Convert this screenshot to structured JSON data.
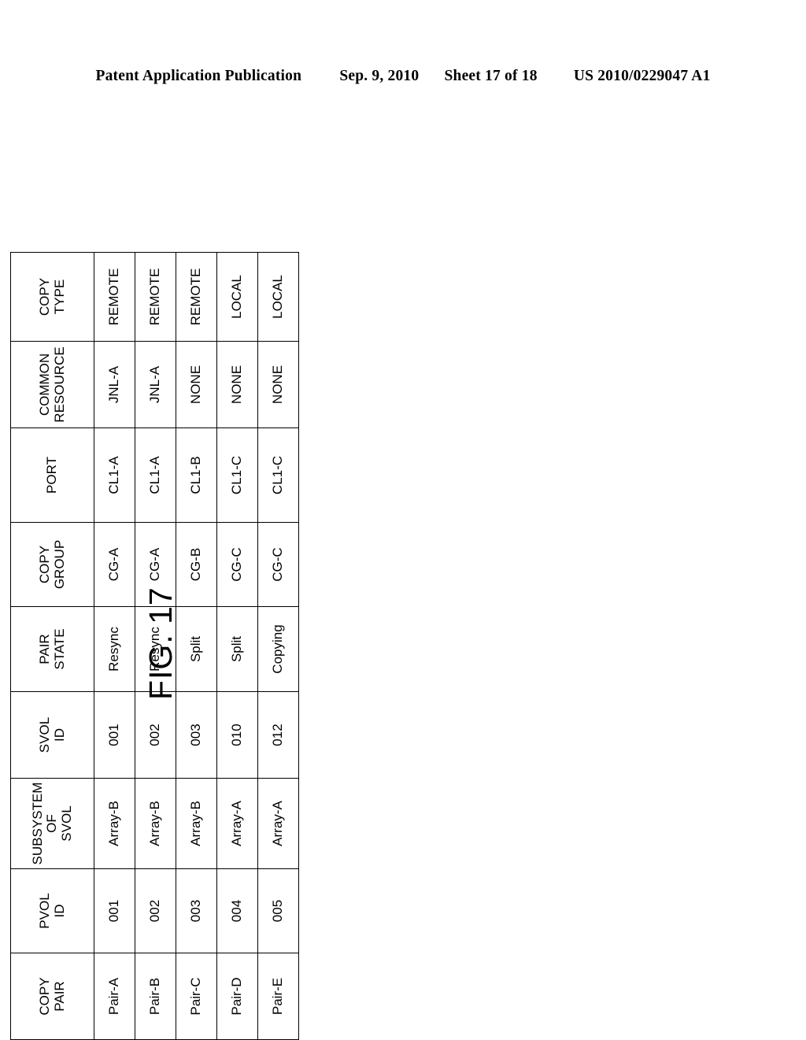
{
  "patent_header": {
    "publication": "Patent Application Publication",
    "date": "Sep. 9, 2010",
    "sheet": "Sheet 17 of 18",
    "number": "US 2010/0229047 A1"
  },
  "figure": {
    "caption": "FIG. 17"
  },
  "table": {
    "headers": [
      {
        "id": "copy-pair",
        "lines": [
          "COPY",
          "PAIR"
        ]
      },
      {
        "id": "pvol-id",
        "lines": [
          "PVOL",
          "ID"
        ]
      },
      {
        "id": "subsystem-of-svol",
        "lines": [
          "SUBSYSTEM",
          "OF",
          "SVOL"
        ]
      },
      {
        "id": "svol-id",
        "lines": [
          "SVOL",
          "ID"
        ]
      },
      {
        "id": "pair-state",
        "lines": [
          "PAIR",
          "STATE"
        ]
      },
      {
        "id": "copy-group",
        "lines": [
          "COPY",
          "GROUP"
        ]
      },
      {
        "id": "port",
        "lines": [
          "PORT"
        ]
      },
      {
        "id": "common-resource",
        "lines": [
          "COMMON",
          "RESOURCE"
        ]
      },
      {
        "id": "copy-type",
        "lines": [
          "COPY",
          "TYPE"
        ]
      }
    ],
    "rows": [
      {
        "copy_pair": "Pair-A",
        "pvol_id": "001",
        "subsystem_of_svol": "Array-B",
        "svol_id": "001",
        "pair_state": "Resync",
        "copy_group": "CG-A",
        "port": "CL1-A",
        "common_resource": "JNL-A",
        "copy_type": "REMOTE"
      },
      {
        "copy_pair": "Pair-B",
        "pvol_id": "002",
        "subsystem_of_svol": "Array-B",
        "svol_id": "002",
        "pair_state": "Resync",
        "copy_group": "CG-A",
        "port": "CL1-A",
        "common_resource": "JNL-A",
        "copy_type": "REMOTE"
      },
      {
        "copy_pair": "Pair-C",
        "pvol_id": "003",
        "subsystem_of_svol": "Array-B",
        "svol_id": "003",
        "pair_state": "Split",
        "copy_group": "CG-B",
        "port": "CL1-B",
        "common_resource": "NONE",
        "copy_type": "REMOTE"
      },
      {
        "copy_pair": "Pair-D",
        "pvol_id": "004",
        "subsystem_of_svol": "Array-A",
        "svol_id": "010",
        "pair_state": "Split",
        "copy_group": "CG-C",
        "port": "CL1-C",
        "common_resource": "NONE",
        "copy_type": "LOCAL"
      },
      {
        "copy_pair": "Pair-E",
        "pvol_id": "005",
        "subsystem_of_svol": "Array-A",
        "svol_id": "012",
        "pair_state": "Copying",
        "copy_group": "CG-C",
        "port": "CL1-C",
        "common_resource": "NONE",
        "copy_type": "LOCAL"
      }
    ]
  }
}
